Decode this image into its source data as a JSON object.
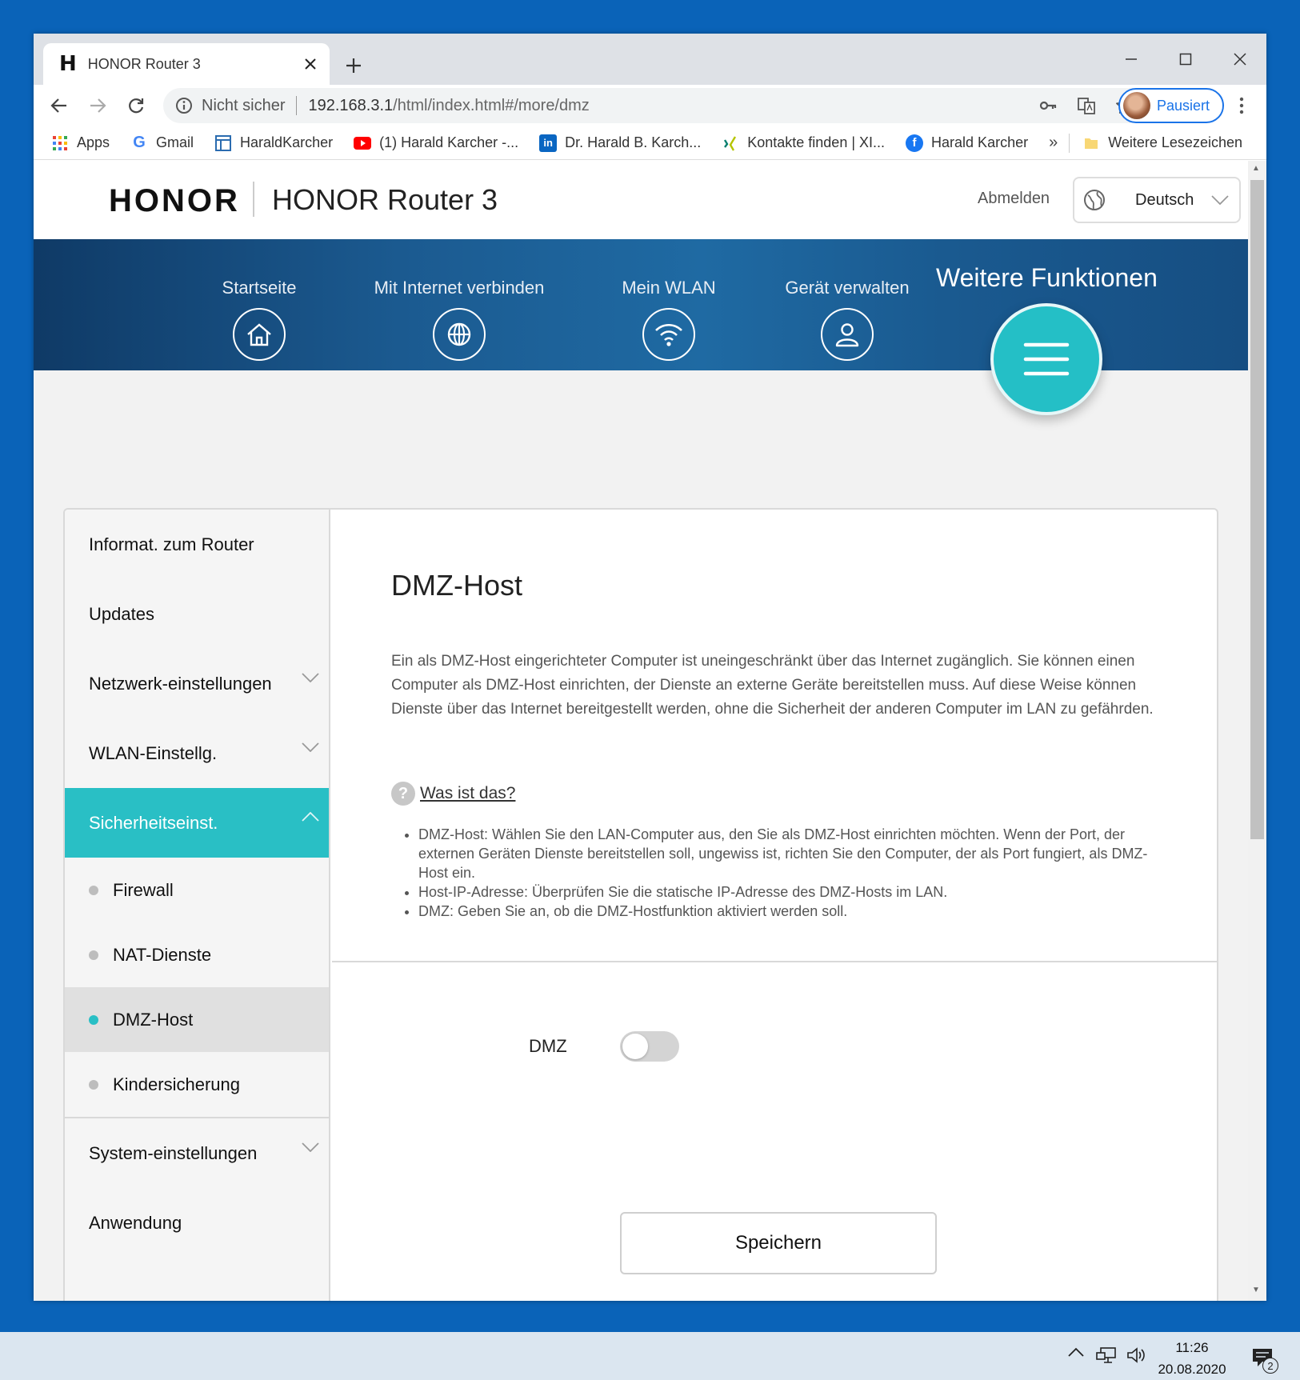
{
  "browser": {
    "tab_title": "HONOR Router 3",
    "tab_favicon": "H",
    "security_label": "Nicht sicher",
    "url_host": "192.168.3.1",
    "url_path": "/html/index.html#/more/dmz",
    "profile_label": "Pausiert",
    "bookmarks": [
      {
        "label": "Apps",
        "icon": "apps-grid-icon"
      },
      {
        "label": "Gmail",
        "icon": "google-icon"
      },
      {
        "label": "HaraldKarcher",
        "icon": "page-icon"
      },
      {
        "label": "(1) Harald Karcher -...",
        "icon": "youtube-icon"
      },
      {
        "label": "Dr. Harald B. Karch...",
        "icon": "linkedin-icon"
      },
      {
        "label": "Kontakte finden | XI...",
        "icon": "xing-icon"
      },
      {
        "label": "Harald Karcher",
        "icon": "facebook-icon"
      }
    ],
    "bookmarks_more": "»",
    "other_bookmarks": "Weitere Lesezeichen"
  },
  "header": {
    "logo": "HONOR",
    "product": "HONOR Router 3",
    "logout": "Abmelden",
    "language": "Deutsch"
  },
  "nav": {
    "items": [
      {
        "label": "Startseite",
        "icon": "home-icon"
      },
      {
        "label": "Mit Internet verbinden",
        "icon": "globe-icon"
      },
      {
        "label": "Mein WLAN",
        "icon": "wifi-icon"
      },
      {
        "label": "Gerät verwalten",
        "icon": "user-icon"
      }
    ],
    "active_label": "Weitere Funktionen",
    "active_icon": "menu-icon"
  },
  "sidebar": {
    "items": [
      {
        "label": "Informat. zum Router"
      },
      {
        "label": "Updates"
      },
      {
        "label": "Netzwerk-einstellungen"
      },
      {
        "label": "WLAN-Einstellg."
      },
      {
        "label": "Sicherheitseinst."
      },
      {
        "label": "System-einstellungen"
      },
      {
        "label": "Anwendung"
      }
    ],
    "sub_items": [
      {
        "label": "Firewall"
      },
      {
        "label": "NAT-Dienste"
      },
      {
        "label": "DMZ-Host"
      },
      {
        "label": "Kindersicherung"
      }
    ]
  },
  "main": {
    "title": "DMZ-Host",
    "description": "Ein als DMZ-Host eingerichteter Computer ist uneingeschränkt über das Internet zugänglich. Sie können einen Computer als DMZ-Host einrichten, der Dienste an externe Geräte bereitstellen muss. Auf diese Weise können Dienste über das Internet bereitgestellt werden, ohne die Sicherheit der anderen Computer im LAN zu gefährden.",
    "help_link": "Was ist das?",
    "help_items": [
      "DMZ-Host: Wählen Sie den LAN-Computer aus, den Sie als DMZ-Host einrichten möchten. Wenn der Port, der externen Geräten Dienste bereitstellen soll, ungewiss ist, richten Sie den Computer, der als Port fungiert, als DMZ-Host ein.",
      "Host-IP-Adresse: Überprüfen Sie die statische IP-Adresse des DMZ-Hosts im LAN.",
      "DMZ: Geben Sie an, ob die DMZ-Hostfunktion aktiviert werden soll."
    ],
    "dmz_label": "DMZ",
    "dmz_enabled": false,
    "save_label": "Speichern"
  },
  "taskbar": {
    "time": "11:26",
    "date": "20.08.2020",
    "notification_count": "2"
  },
  "colors": {
    "accent": "#29bfc5",
    "banner": "#1b5a90",
    "desktop": "#0a63b8"
  }
}
